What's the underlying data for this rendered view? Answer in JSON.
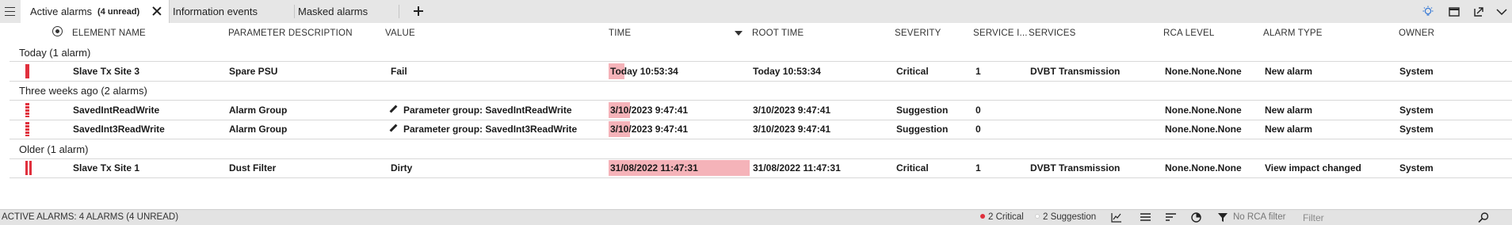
{
  "tabs": [
    {
      "label": "Active alarms",
      "badge": "(4 unread)",
      "active": true
    },
    {
      "label": "Information events"
    },
    {
      "label": "Masked alarms"
    }
  ],
  "columns": [
    "ELEMENT NAME",
    "PARAMETER DESCRIPTION",
    "VALUE",
    "TIME",
    "ROOT TIME",
    "SEVERITY",
    "SERVICE I...",
    "SERVICES",
    "RCA LEVEL",
    "ALARM TYPE",
    "OWNER"
  ],
  "groups": [
    {
      "label": "Today (1 alarm)",
      "rows": [
        {
          "element": "Slave Tx Site 3",
          "param": "Spare PSU",
          "value": "Fail",
          "time": "Today 10:53:34",
          "root_time": "Today 10:53:34",
          "severity": "Critical",
          "service_impact": "1",
          "services": "DVBT Transmission",
          "rca": "None.None.None",
          "alarm_type": "New alarm",
          "owner": "System",
          "time_bar": 0.12
        }
      ]
    },
    {
      "label": "Three weeks ago (2 alarms)",
      "rows": [
        {
          "element": "SavedIntReadWrite",
          "param": "Alarm Group",
          "value": "Parameter group: SavedIntReadWrite",
          "time": "3/10/2023 9:47:41",
          "root_time": "3/10/2023 9:47:41",
          "severity": "Suggestion",
          "service_impact": "0",
          "services": "",
          "rca": "None.None.None",
          "alarm_type": "New alarm",
          "owner": "System",
          "time_bar": 0.14
        },
        {
          "element": "SavedInt3ReadWrite",
          "param": "Alarm Group",
          "value": "Parameter group: SavedInt3ReadWrite",
          "time": "3/10/2023 9:47:41",
          "root_time": "3/10/2023 9:47:41",
          "severity": "Suggestion",
          "service_impact": "0",
          "services": "",
          "rca": "None.None.None",
          "alarm_type": "New alarm",
          "owner": "System",
          "time_bar": 0.14
        }
      ]
    },
    {
      "label": "Older (1 alarm)",
      "rows": [
        {
          "element": "Slave Tx Site 1",
          "param": "Dust Filter",
          "value": "Dirty",
          "time": "31/08/2022 11:47:31",
          "root_time": "31/08/2022 11:47:31",
          "severity": "Critical",
          "service_impact": "1",
          "services": "DVBT Transmission",
          "rca": "None.None.None",
          "alarm_type": "View impact changed",
          "owner": "System",
          "time_bar": 1.0
        }
      ]
    }
  ],
  "status": {
    "summary": "ACTIVE ALARMS: 4 ALARMS (4 UNREAD)",
    "critical": "2 Critical",
    "suggestion": "2 Suggestion",
    "rca_filter": "No RCA filter",
    "filter_placeholder": "Filter"
  },
  "colors": {
    "critical": "#e0303d",
    "time_highlight": "#f5b3b9",
    "suggestion_dot": "#ffffff"
  },
  "icons": [
    "menu-icon",
    "close-icon",
    "plus-icon",
    "lightbulb-icon",
    "window-icon",
    "pop-out-icon",
    "chevron-down-icon",
    "target-icon",
    "sort-desc-icon",
    "pencil-icon",
    "trend-icon",
    "list-icon",
    "sort-lines-icon",
    "pie-icon",
    "funnel-icon",
    "search-icon"
  ]
}
